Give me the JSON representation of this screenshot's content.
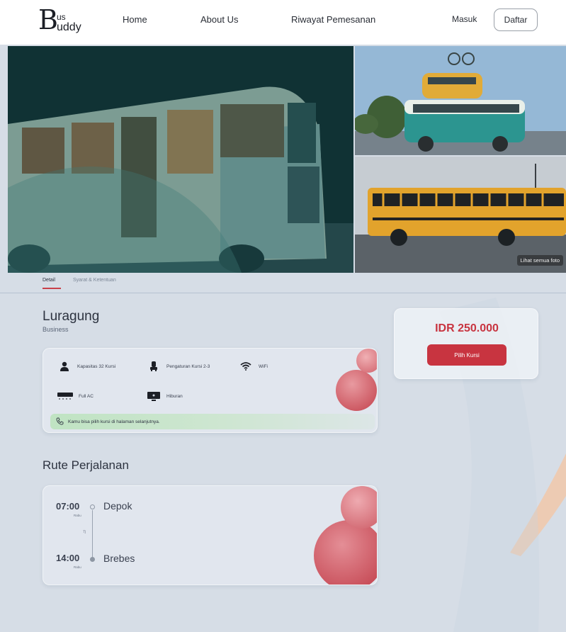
{
  "nav": {
    "logo_b": "B",
    "logo_us": "us",
    "logo_uddy": "uddy",
    "links": [
      "Home",
      "About Us",
      "Riwayat Pemesanan"
    ],
    "masuk_label": "Masuk",
    "daftar_label": "Daftar"
  },
  "gallery": {
    "see_all_label": "Lihat semua foto"
  },
  "tabs": [
    "Detail",
    "Syarat & Ketentuan"
  ],
  "bus": {
    "name": "Luragung",
    "class": "Business"
  },
  "facilities": [
    {
      "icon": "person-icon",
      "label": "Kapasitas 32 Kursi"
    },
    {
      "icon": "seat-icon",
      "label": "Pengaturan Kursi 2-3"
    },
    {
      "icon": "wifi-icon",
      "label": "WiFi"
    },
    {
      "icon": "ac-icon",
      "label": "Full AC"
    },
    {
      "icon": "tv-icon",
      "label": "Hiburan"
    }
  ],
  "info_note": "Kamu bisa pilih kursi di halaman selanjutnya.",
  "price": {
    "amount": "IDR 250.000",
    "button_label": "Pilih Kursi"
  },
  "route": {
    "section_title": "Rute Perjalanan",
    "departure": {
      "time": "07:00",
      "day": "Rabu",
      "city": "Depok"
    },
    "duration": "7j",
    "arrival": {
      "time": "14:00",
      "day": "Rabu",
      "city": "Brebes"
    }
  },
  "colors": {
    "accent": "#c83440",
    "background": "#d6dde6",
    "info_green": "#bce3be"
  }
}
